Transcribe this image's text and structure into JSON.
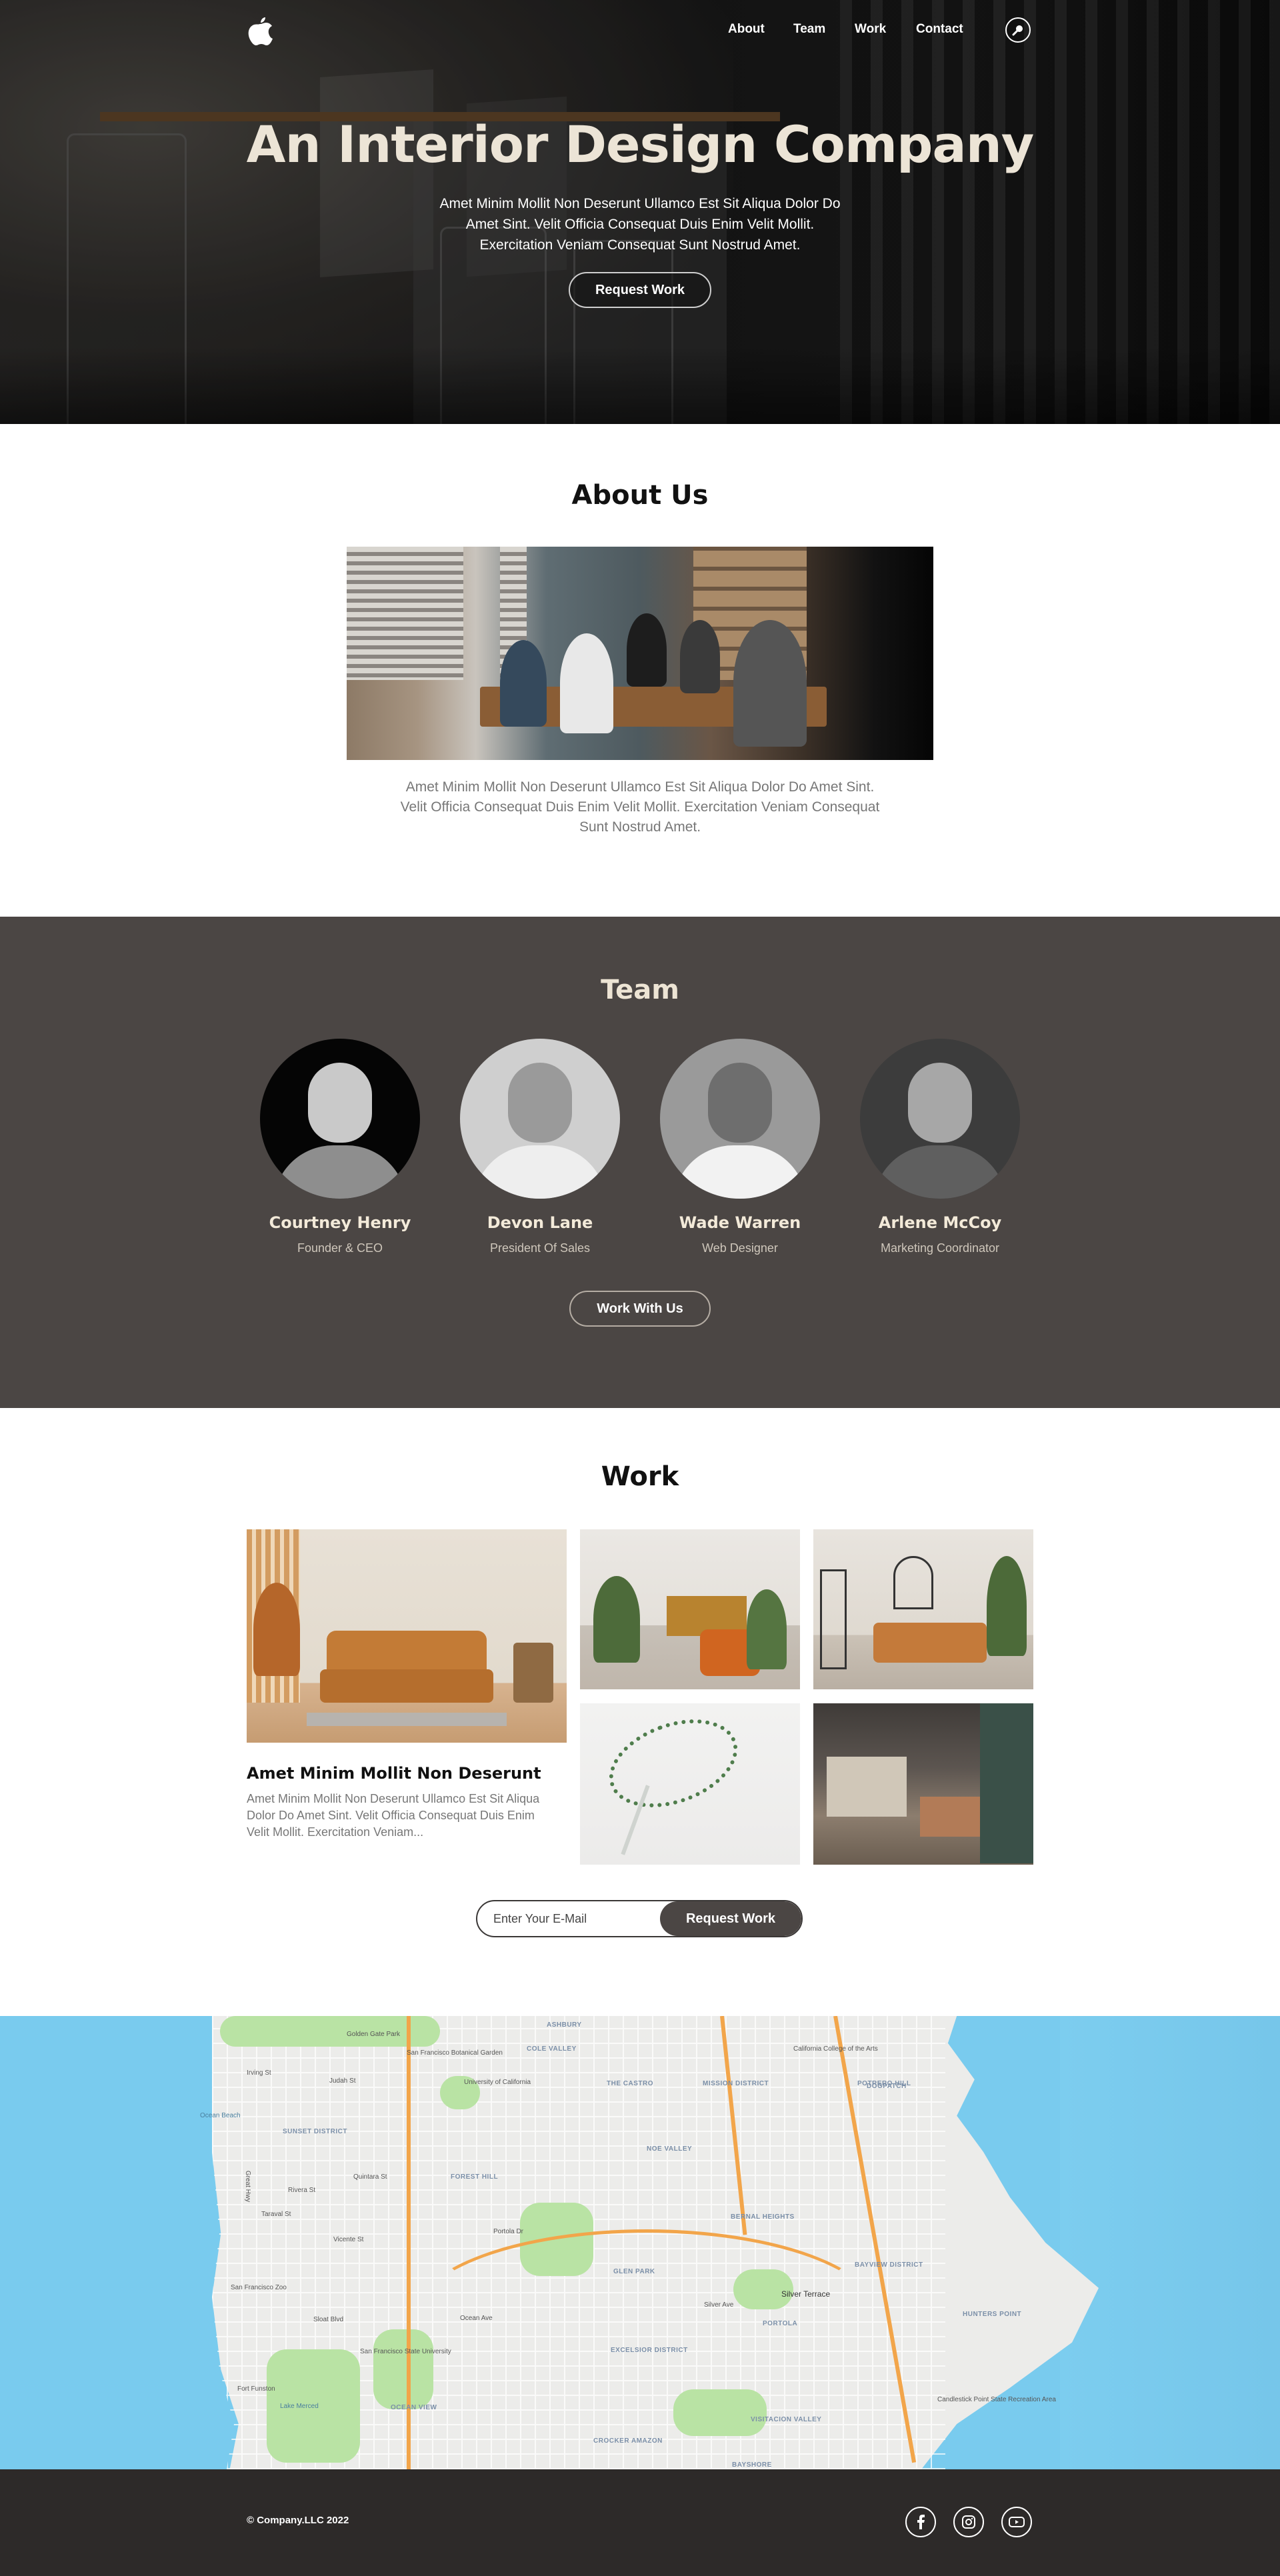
{
  "nav": {
    "logo_icon": "apple-logo-icon",
    "links": [
      "About",
      "Team",
      "Work",
      "Contact"
    ],
    "search_icon": "search-icon"
  },
  "hero": {
    "title": "An Interior Design Company",
    "text": "Amet Minim Mollit Non Deserunt Ullamco Est Sit Aliqua Dolor Do Amet Sint. Velit Officia Consequat Duis Enim Velit Mollit. Exercitation Veniam Consequat Sunt Nostrud Amet.",
    "button": "Request Work"
  },
  "about": {
    "title": "About Us",
    "text": "Amet Minim Mollit Non Deserunt Ullamco Est Sit Aliqua Dolor Do Amet Sint. Velit Officia Consequat Duis Enim Velit Mollit. Exercitation Veniam Consequat Sunt Nostrud Amet."
  },
  "team": {
    "title": "Team",
    "members": [
      {
        "name": "Courtney Henry",
        "role": "Founder & CEO"
      },
      {
        "name": "Devon Lane",
        "role": "President Of Sales"
      },
      {
        "name": "Wade Warren",
        "role": "Web Designer"
      },
      {
        "name": "Arlene McCoy",
        "role": "Marketing Coordinator"
      }
    ],
    "button": "Work With Us"
  },
  "work": {
    "title": "Work",
    "heading": "Amet Minim Mollit Non Deserunt",
    "desc": "Amet Minim Mollit Non Deserunt Ullamco Est Sit Aliqua Dolor Do Amet Sint. Velit Officia Consequat Duis Enim Velit Mollit. Exercitation Veniam...",
    "email_placeholder": "Enter Your E-Mail",
    "button": "Request Work"
  },
  "map": {
    "labels": [
      "Golden Gate Park",
      "San Francisco Botanical Garden",
      "COLE VALLEY",
      "ASHBURY",
      "California College of the Arts",
      "Irving St",
      "Judah St",
      "University of California",
      "THE CASTRO",
      "MISSION DISTRICT",
      "POTRERO HILL",
      "DOGPATCH",
      "Ocean Beach",
      "SUNSET DISTRICT",
      "Quintara St",
      "FOREST HILL",
      "NOE VALLEY",
      "Rivera St",
      "Taraval St",
      "Vicente St",
      "San Francisco Zoo",
      "Portola Dr",
      "GLEN PARK",
      "BERNAL HEIGHTS",
      "BAYVIEW DISTRICT",
      "HUNTERS POINT",
      "Silver Terrace",
      "Silver Ave",
      "PORTOLA",
      "EXCELSIOR DISTRICT",
      "San Francisco State University",
      "Fort Funston",
      "Lake Merced",
      "OCEAN VIEW",
      "Candlestick Point State Recreation Area",
      "VISITACION VALLEY",
      "CROCKER AMAZON",
      "BAYSHORE",
      "Sloat Blvd",
      "Ocean Ave",
      "Great Hwy"
    ]
  },
  "footer": {
    "copyright": "© Company.LLC 2022",
    "social": [
      "facebook-icon",
      "instagram-icon",
      "youtube-icon"
    ]
  }
}
